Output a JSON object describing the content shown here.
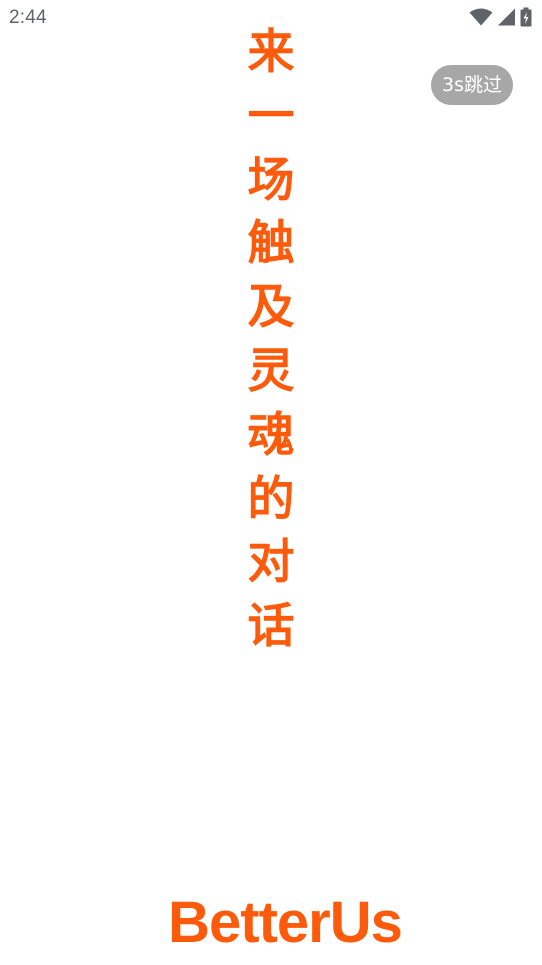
{
  "status_bar": {
    "time": "2:44",
    "icons": [
      "wifi-icon",
      "cellular-signal-icon",
      "battery-charging-icon"
    ]
  },
  "skip_button": {
    "label": "3s跳过"
  },
  "slogan": {
    "characters": [
      "来",
      "一",
      "场",
      "触",
      "及",
      "灵",
      "魂",
      "的",
      "对",
      "话"
    ]
  },
  "brand": {
    "name": "BetterUs"
  },
  "colors": {
    "accent": "#fd5b0b",
    "skip_bg": "#a7a7a7",
    "status_text": "#5f6368",
    "background": "#ffffff"
  }
}
